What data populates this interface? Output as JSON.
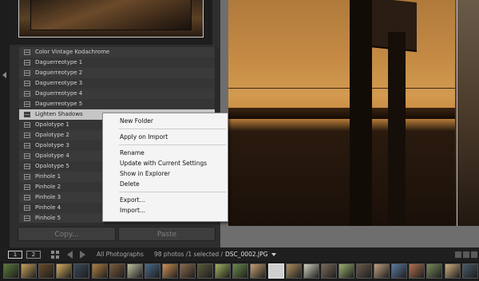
{
  "presets": {
    "items": [
      {
        "label": "Color Vintage Kodachrome"
      },
      {
        "label": "Daguerreotype 1"
      },
      {
        "label": "Daguerreotype 2"
      },
      {
        "label": "Daguerreotype 3"
      },
      {
        "label": "Daguerreotype 4"
      },
      {
        "label": "Daguerreotype 5"
      },
      {
        "label": "Lighten Shadows"
      },
      {
        "label": "Opalotype 1"
      },
      {
        "label": "Opalotype 2"
      },
      {
        "label": "Opalotype 3"
      },
      {
        "label": "Opalotype 4"
      },
      {
        "label": "Opalotype 5"
      },
      {
        "label": "Pinhole 1"
      },
      {
        "label": "Pinhole 2"
      },
      {
        "label": "Pinhole 3"
      },
      {
        "label": "Pinhole 4"
      },
      {
        "label": "Pinhole 5"
      }
    ],
    "selected_index": 6
  },
  "actions": {
    "copy_label": "Copy...",
    "paste_label": "Paste"
  },
  "context_menu": {
    "new_folder": "New Folder",
    "apply_on_import": "Apply on Import",
    "rename": "Rename",
    "update_with_current": "Update with Current Settings",
    "show_in_explorer": "Show in Explorer",
    "delete": "Delete",
    "export": "Export...",
    "import": "Import..."
  },
  "filmstrip": {
    "page_1": "1",
    "page_2": "2",
    "source": "All Photographs",
    "count": "98 photos /1 selected /",
    "filename": "DSC_0002.JPG",
    "thumb_colors": [
      "#5a7a3a",
      "#c9a15a",
      "#6a4a2a",
      "#d8b060",
      "#3a4a5a",
      "#b08040",
      "#7a5a3a",
      "#c0c0a0",
      "#4a6a8a",
      "#d09050",
      "#8a6a4a",
      "#5a5a3a",
      "#a0b060",
      "#6a8a4a",
      "#c8a070",
      "#3a3a3a",
      "#b09060",
      "#d0d0c0",
      "#7a6a5a",
      "#9ab070",
      "#6a5a4a",
      "#c0a080",
      "#5a7aa0",
      "#b07050",
      "#7a8a5a",
      "#d0b080",
      "#4a5a6a",
      "#a08060"
    ],
    "selected_thumb_index": 15
  }
}
